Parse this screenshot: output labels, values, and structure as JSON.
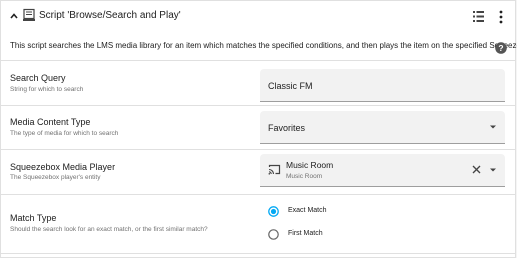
{
  "header": {
    "title": "Script 'Browse/Search and Play'",
    "icons": [
      "chevron-up-icon",
      "script-icon",
      "list-icon",
      "more-vert-icon"
    ]
  },
  "description": "This script searches the LMS media library for an item which matches the specified conditions, and then plays the item on the specified Squeezebox",
  "fields": {
    "search_query": {
      "label": "Search Query",
      "sublabel": "String for which to search",
      "value": "Classic FM"
    },
    "media_type": {
      "label": "Media Content Type",
      "sublabel": "The type of media for which to search",
      "value": "Favorites"
    },
    "player": {
      "label": "Squeezebox Media Player",
      "sublabel": "The Squeezebox player's entity",
      "value": "Music Room",
      "value_sub": "Music Room"
    },
    "match_type": {
      "label": "Match Type",
      "sublabel": "Should the search look for an exact match, or the first similar match?",
      "options": [
        "Exact Match",
        "First Match"
      ],
      "selected": "Exact Match"
    }
  },
  "colors": {
    "accent": "#03a9f4",
    "divider": "#e0e0e0",
    "field_bg": "#f2f2f2",
    "secondary_text": "#727272"
  }
}
